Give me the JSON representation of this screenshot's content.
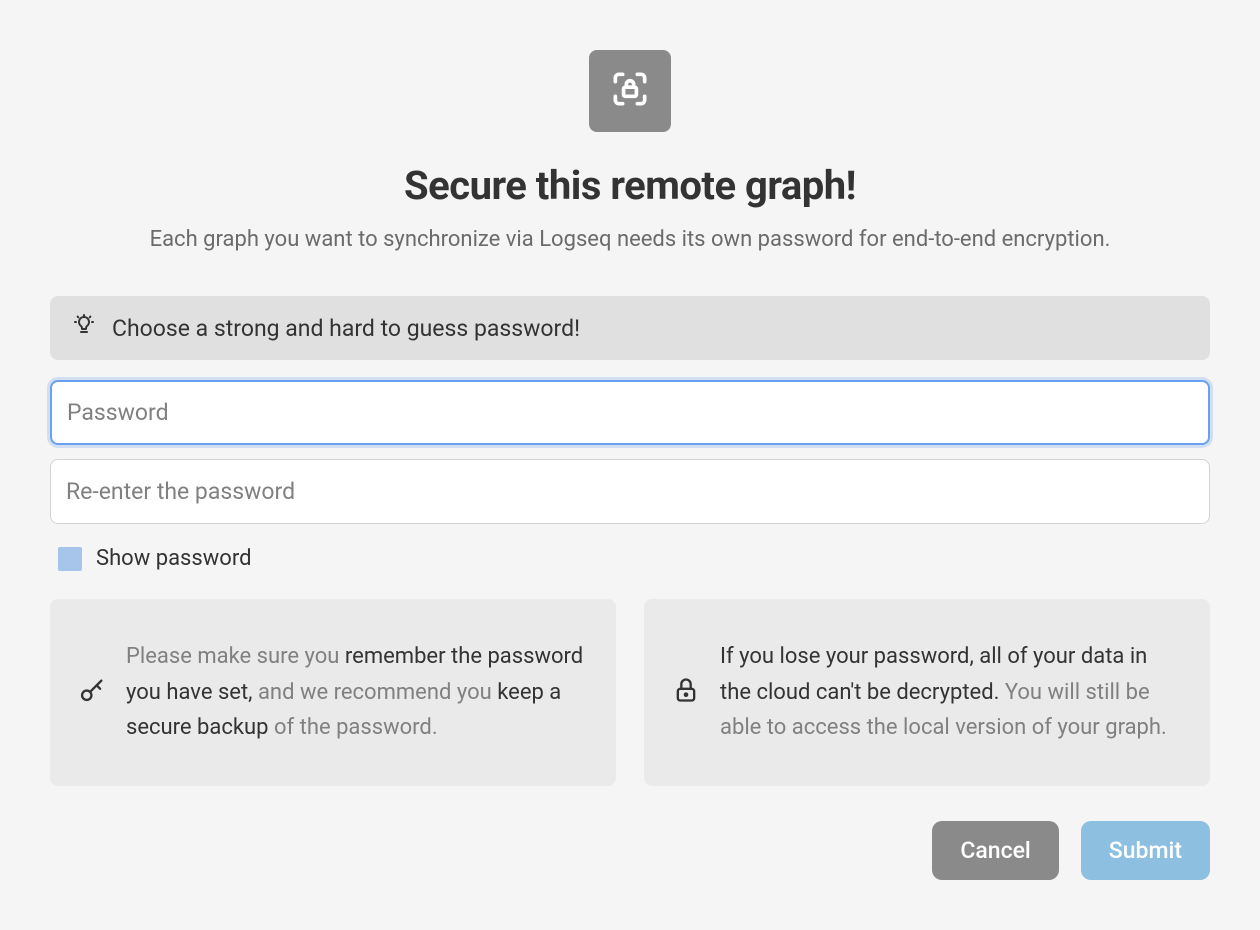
{
  "header": {
    "title": "Secure this remote graph!",
    "subtitle": "Each graph you want to synchronize via Logseq needs its own password for end-to-end encryption."
  },
  "hint": {
    "text": "Choose a strong and hard to guess password!"
  },
  "fields": {
    "password": {
      "placeholder": "Password",
      "value": ""
    },
    "confirm": {
      "placeholder": "Re-enter the password",
      "value": ""
    }
  },
  "showPassword": {
    "label": "Show password",
    "checked": false
  },
  "infoCards": {
    "remember": {
      "prefix": "Please make sure you ",
      "strong1": "remember the password you have set,",
      "mid": " and we recommend you ",
      "strong2": "keep a secure backup",
      "suffix": " of the password."
    },
    "lose": {
      "strong": "If you lose your password, all of your data in the cloud can't be decrypted.",
      "rest": " You will still be able to access the local version of your graph."
    }
  },
  "buttons": {
    "cancel": "Cancel",
    "submit": "Submit"
  }
}
